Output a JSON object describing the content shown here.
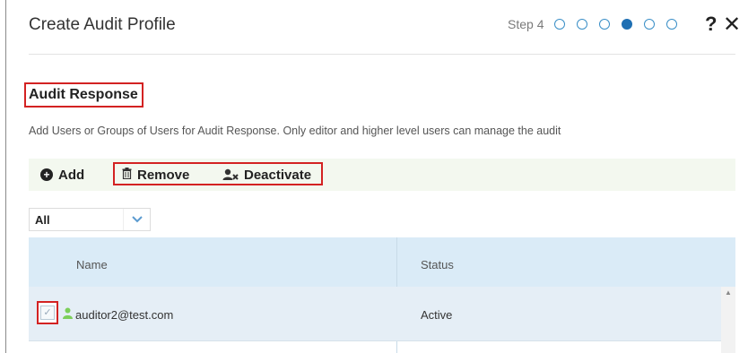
{
  "header": {
    "title": "Create Audit Profile",
    "step_label": "Step 4",
    "steps_total": 6,
    "current_step": 4,
    "help_label": "?",
    "close_label": "✕"
  },
  "section": {
    "title": "Audit Response",
    "description": "Add Users or Groups of Users for Audit Response. Only editor and higher level users can manage the audit"
  },
  "toolbar": {
    "add_label": "Add",
    "remove_label": "Remove",
    "deactivate_label": "Deactivate"
  },
  "filter": {
    "selected": "All"
  },
  "table": {
    "columns": [
      "Name",
      "Status"
    ],
    "rows": [
      {
        "name": "auditor2@test.com",
        "status": "Active",
        "checked": true
      }
    ]
  },
  "colors": {
    "accent": "#1e6fb3",
    "highlight_box": "#d32222",
    "toolbar_bg": "#f3f8ef",
    "header_bg": "#daebf7",
    "user_icon": "#7ccf5a"
  }
}
